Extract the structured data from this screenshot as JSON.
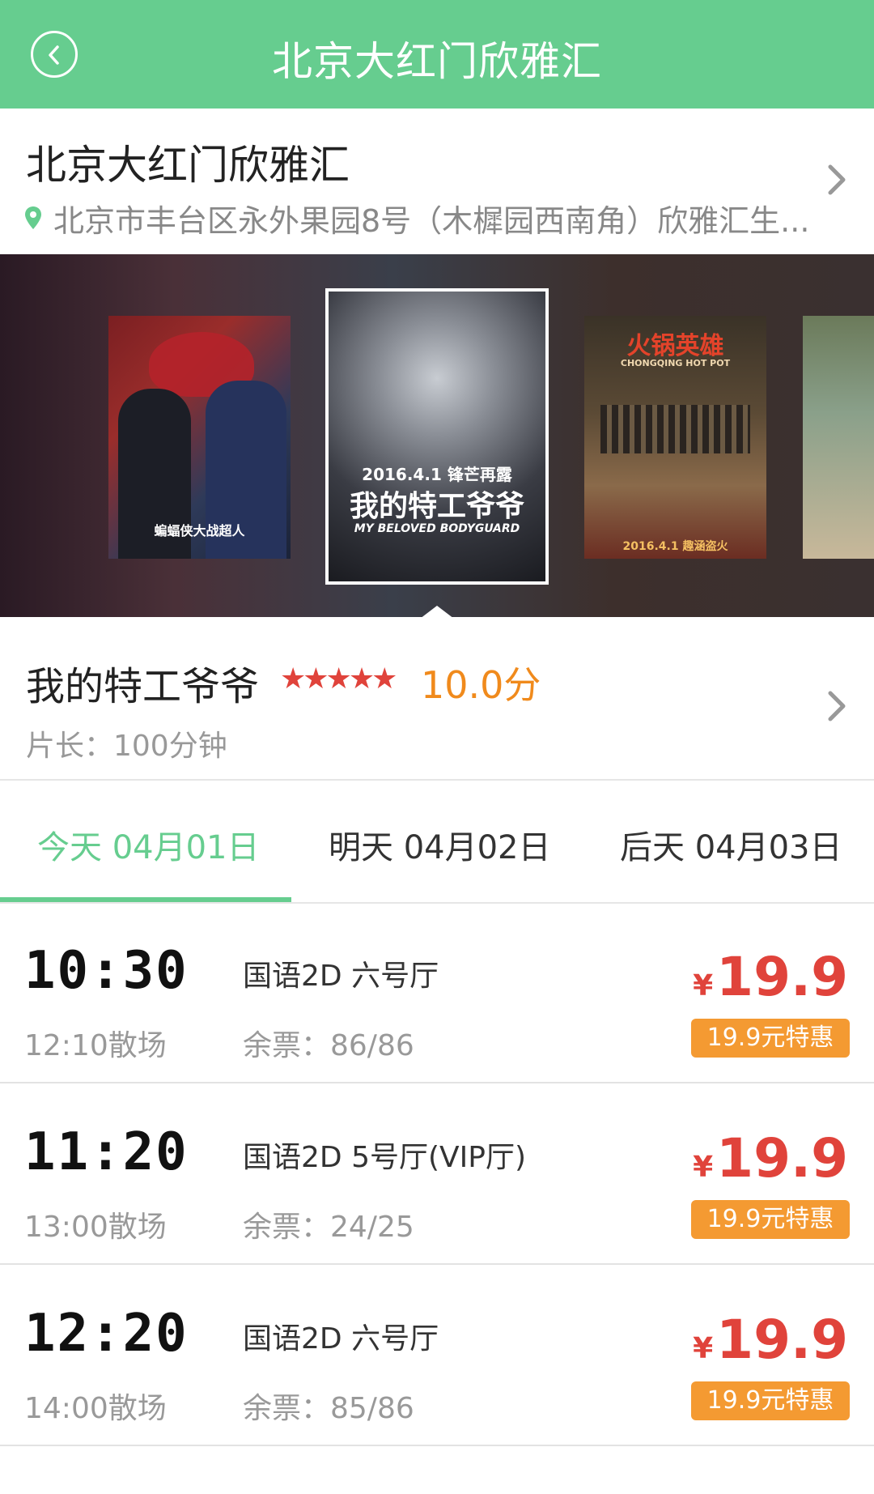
{
  "header": {
    "title": "北京大红门欣雅汇",
    "back_icon": "back-arrow-icon",
    "color": "#66cd8f"
  },
  "cinema": {
    "name": "北京大红门欣雅汇",
    "address": "北京市丰台区永外果园8号（木樨园西南角）欣雅汇生..."
  },
  "carousel": {
    "posters": [
      {
        "caption": "蝙蝠侠大战超人"
      },
      {
        "date": "2016.4.1 锋芒再露",
        "title": "我的特工爷爷",
        "title_en": "MY BELOVED BODYGUARD"
      },
      {
        "title": "火锅英雄",
        "subtitle": "CHONGQING HOT POT",
        "date": "2016.4.1 趣涵盗火"
      },
      {
        "title": ""
      }
    ]
  },
  "movie": {
    "title": "我的特工爷爷",
    "stars": "★★★★★",
    "score": "10.0分",
    "duration": "片长：100分钟"
  },
  "tabs": [
    {
      "label": "今天 04月01日",
      "active": true
    },
    {
      "label": "明天 04月02日",
      "active": false
    },
    {
      "label": "后天 04月03日",
      "active": false
    }
  ],
  "showtimes": [
    {
      "time": "10:30",
      "end": "12:10散场",
      "hall": "国语2D  六号厅",
      "seats": "余票：86/86",
      "currency": "¥",
      "price": "19.9",
      "promo": "19.9元特惠"
    },
    {
      "time": "11:20",
      "end": "13:00散场",
      "hall": "国语2D  5号厅(VIP厅)",
      "seats": "余票：24/25",
      "currency": "¥",
      "price": "19.9",
      "promo": "19.9元特惠"
    },
    {
      "time": "12:20",
      "end": "14:00散场",
      "hall": "国语2D  六号厅",
      "seats": "余票：85/86",
      "currency": "¥",
      "price": "19.9",
      "promo": "19.9元特惠"
    }
  ]
}
